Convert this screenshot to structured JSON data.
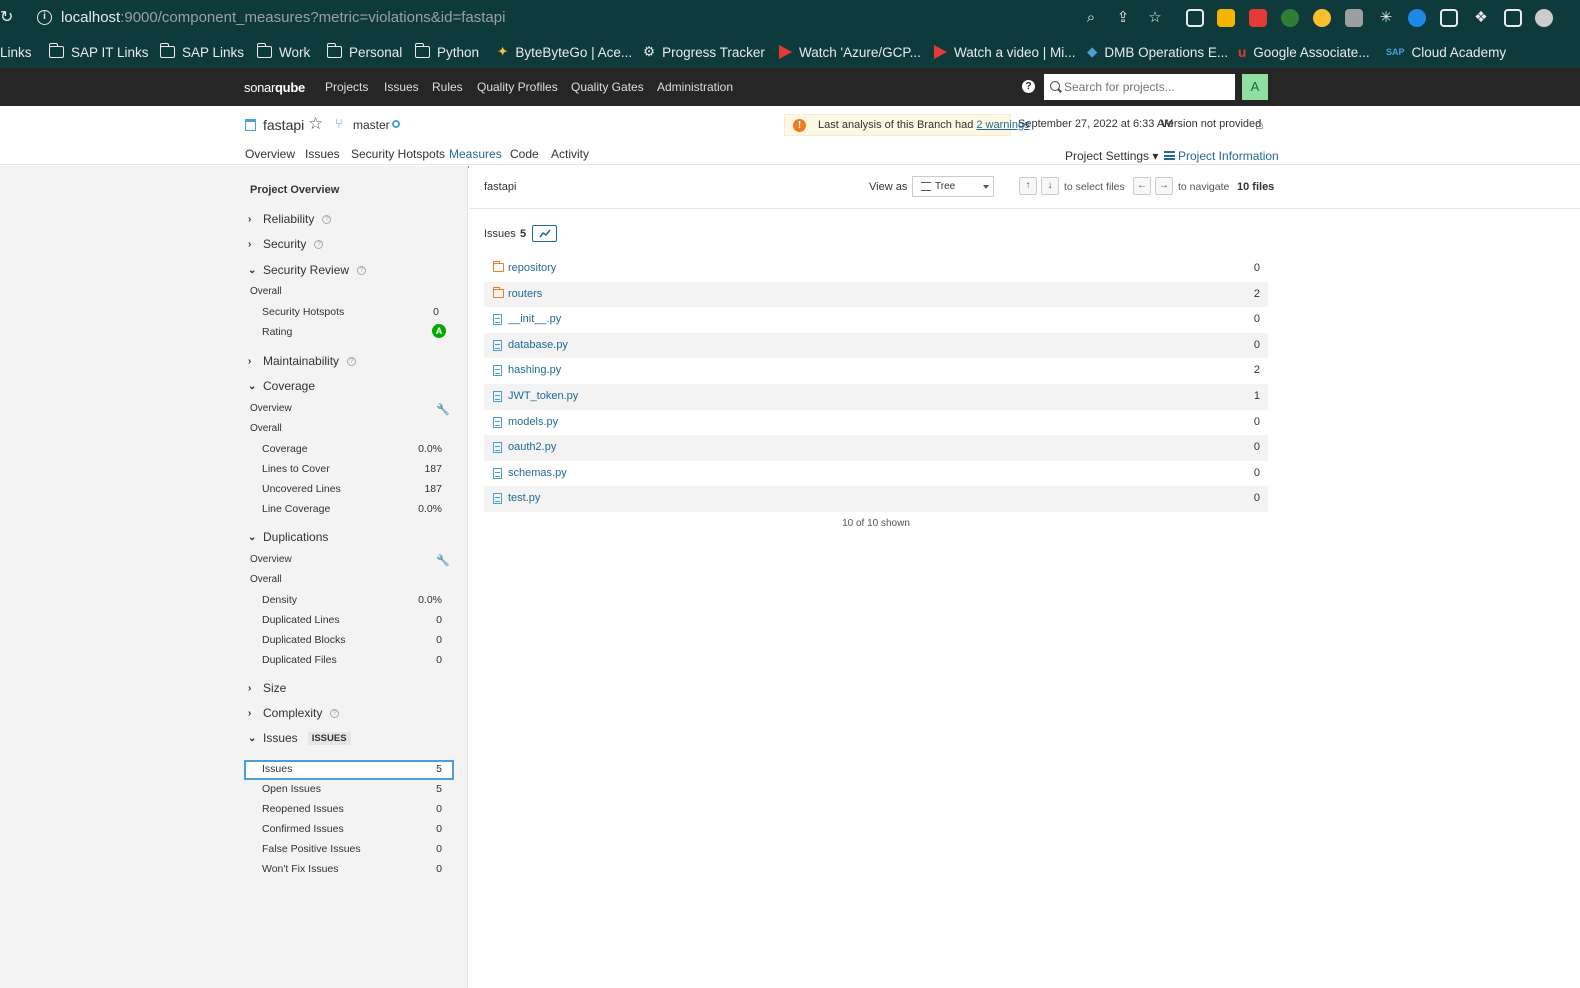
{
  "browser": {
    "url_host": "localhost",
    "url_rest": ":9000/component_measures?metric=violations&id=fastapi",
    "bookmarks": [
      "Links",
      "SAP IT Links",
      "SAP Links",
      "Work",
      "Personal",
      "Python",
      "ByteByteGo | Ace...",
      "Progress Tracker",
      "Watch 'Azure/GCP...",
      "Watch a video | Mi...",
      "DMB Operations E...",
      "Google Associate...",
      "Cloud Academy"
    ]
  },
  "nav": {
    "logo_a": "sonar",
    "logo_b": "qube",
    "links": [
      "Projects",
      "Issues",
      "Rules",
      "Quality Profiles",
      "Quality Gates",
      "Administration"
    ],
    "search_placeholder": "Search for projects...",
    "avatar": "A",
    "help": "?"
  },
  "project": {
    "name": "fastapi",
    "branch": "master",
    "warning_prefix": "Last analysis of this Branch had ",
    "warning_link": "2 warnings",
    "analysis_date": "September 27, 2022 at 6:33 AM",
    "version": "Version not provided",
    "tabs": [
      "Overview",
      "Issues",
      "Security Hotspots",
      "Measures",
      "Code",
      "Activity"
    ],
    "settings": "Project Settings",
    "info": "Project Information"
  },
  "sidebar": {
    "title": "Project Overview",
    "reliability": "Reliability",
    "security": "Security",
    "security_review": "Security Review",
    "overall": "Overall",
    "hotspots_label": "Security Hotspots",
    "hotspots_val": "0",
    "rating_label": "Rating",
    "rating_val": "A",
    "maintainability": "Maintainability",
    "coverage": "Coverage",
    "overview": "Overview",
    "coverage_items": [
      {
        "label": "Coverage",
        "value": "0.0%"
      },
      {
        "label": "Lines to Cover",
        "value": "187"
      },
      {
        "label": "Uncovered Lines",
        "value": "187"
      },
      {
        "label": "Line Coverage",
        "value": "0.0%"
      }
    ],
    "duplications": "Duplications",
    "dup_items": [
      {
        "label": "Density",
        "value": "0.0%"
      },
      {
        "label": "Duplicated Lines",
        "value": "0"
      },
      {
        "label": "Duplicated Blocks",
        "value": "0"
      },
      {
        "label": "Duplicated Files",
        "value": "0"
      }
    ],
    "size": "Size",
    "complexity": "Complexity",
    "issues": "Issues",
    "issues_tag": "ISSUES",
    "issue_items": [
      {
        "label": "Issues",
        "value": "5"
      },
      {
        "label": "Open Issues",
        "value": "5"
      },
      {
        "label": "Reopened Issues",
        "value": "0"
      },
      {
        "label": "Confirmed Issues",
        "value": "0"
      },
      {
        "label": "False Positive Issues",
        "value": "0"
      },
      {
        "label": "Won't Fix Issues",
        "value": "0"
      }
    ]
  },
  "main": {
    "root": "fastapi",
    "view_as": "View as",
    "view_mode": "Tree",
    "select_files": "to select files",
    "navigate": "to navigate",
    "files_count": "10 files",
    "metric_label": "Issues",
    "metric_value": "5",
    "files": [
      {
        "name": "repository",
        "value": "0",
        "type": "dir"
      },
      {
        "name": "routers",
        "value": "2",
        "type": "dir"
      },
      {
        "name": "__init__.py",
        "value": "0",
        "type": "file"
      },
      {
        "name": "database.py",
        "value": "0",
        "type": "file"
      },
      {
        "name": "hashing.py",
        "value": "2",
        "type": "file"
      },
      {
        "name": "JWT_token.py",
        "value": "1",
        "type": "file"
      },
      {
        "name": "models.py",
        "value": "0",
        "type": "file"
      },
      {
        "name": "oauth2.py",
        "value": "0",
        "type": "file"
      },
      {
        "name": "schemas.py",
        "value": "0",
        "type": "file"
      },
      {
        "name": "test.py",
        "value": "0",
        "type": "file"
      }
    ],
    "shown": "10 of 10 shown"
  }
}
